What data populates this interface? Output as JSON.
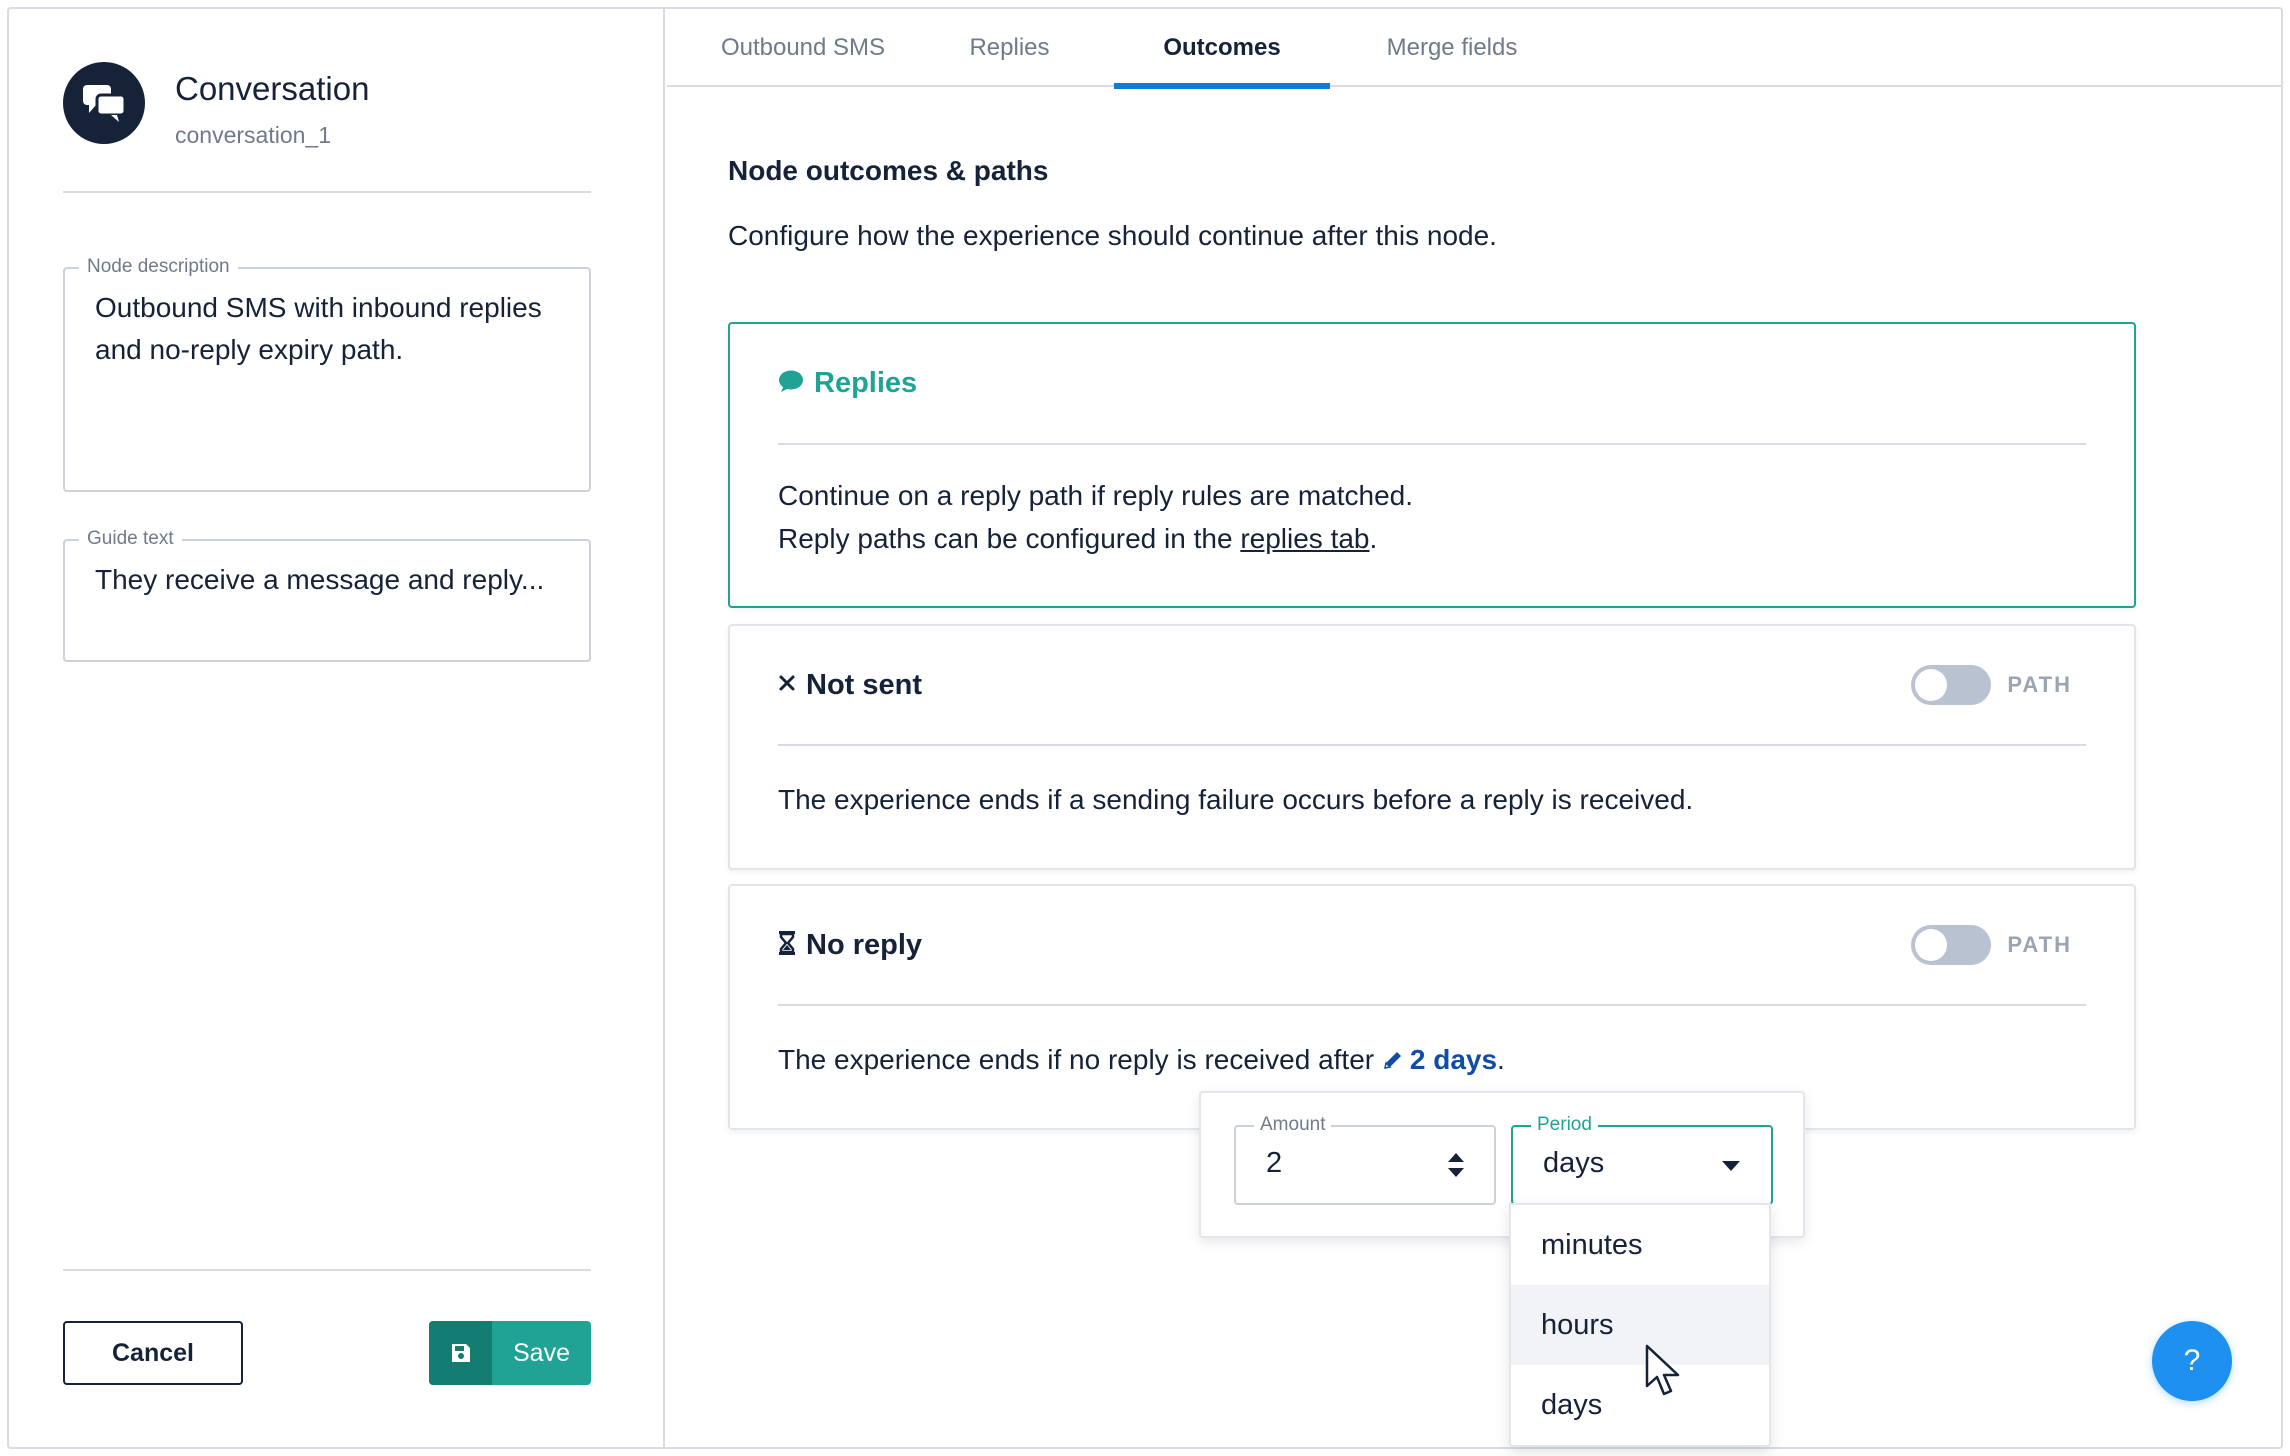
{
  "node": {
    "title": "Conversation",
    "id": "conversation_1",
    "icon": "chat-bubbles-icon"
  },
  "fields": {
    "description_label": "Node description",
    "description_value": "Outbound SMS with  inbound replies and no-reply expiry path.",
    "guide_label": "Guide text",
    "guide_value": "They receive a message and reply..."
  },
  "actions": {
    "cancel_label": "Cancel",
    "save_label": "Save"
  },
  "tabs": [
    {
      "label": "Outbound SMS",
      "active": false
    },
    {
      "label": "Replies",
      "active": false
    },
    {
      "label": "Outcomes",
      "active": true
    },
    {
      "label": "Merge fields",
      "active": false
    }
  ],
  "section": {
    "title": "Node outcomes & paths",
    "description": "Configure how the experience should continue after this node."
  },
  "cards": {
    "replies": {
      "title": "Replies",
      "line1": "Continue on a reply path if reply rules are matched.",
      "line2_prefix": "Reply paths can be configured in the ",
      "line2_link": "replies tab",
      "line2_suffix": "."
    },
    "not_sent": {
      "title": "Not sent",
      "toggle_label": "PATH",
      "toggle_on": false,
      "body": "The experience ends if a sending failure occurs before a reply is received."
    },
    "no_reply": {
      "title": "No reply",
      "toggle_label": "PATH",
      "toggle_on": false,
      "body_prefix": "The experience ends if no reply is received after ",
      "duration": "2 days",
      "body_suffix": "."
    }
  },
  "popover": {
    "amount_label": "Amount",
    "amount_value": "2",
    "period_label": "Period",
    "period_value": "days",
    "options": [
      "minutes",
      "hours",
      "days"
    ],
    "hovered_option": "hours"
  },
  "help": {
    "label": "?"
  },
  "colors": {
    "navy": "#152238",
    "teal": "#20a394",
    "blue_tab": "#0e7bd6",
    "link_blue": "#0f4ea3",
    "help_blue": "#1e90ef"
  }
}
